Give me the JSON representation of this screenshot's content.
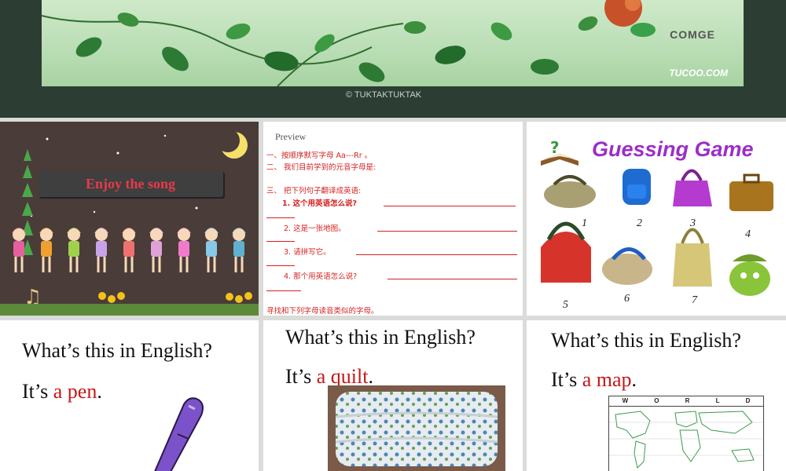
{
  "banner": {
    "brand_top": "COMGE",
    "brand_bottom": "TUCOO.COM",
    "credit": "© TUKTAKTUKTAK"
  },
  "slide1": {
    "title": "Enjoy the song"
  },
  "slide2": {
    "preview": "Preview",
    "line1": "一、按顺序默写字母 Aa---Rr 。",
    "line2": "二、 我们目前学到的元音字母是:",
    "line3": "三、 把下列句子翻译成英语:",
    "q1": "1. 这个用英语怎么说?",
    "q2": "2. 这是一张地图。",
    "q3": "3. 请拼写它。",
    "q4": "4. 那个用英语怎么说?",
    "footer": "寻找和下列字母读音类似的字母。"
  },
  "slide3": {
    "title": "Guessing   Game",
    "numbers": [
      "1",
      "2",
      "3",
      "4",
      "5",
      "6",
      "7"
    ]
  },
  "slide4": {
    "question": "What’s this in English?",
    "answer_prefix": "It’s ",
    "answer": "a pen",
    "answer_suffix": "."
  },
  "slide5": {
    "question": "What’s this in English?",
    "answer_prefix": "It’s ",
    "answer": "a quilt",
    "answer_suffix": "."
  },
  "slide6": {
    "question": "What’s this in English?",
    "answer_prefix": "It’s ",
    "answer": "a map",
    "answer_suffix": ".",
    "map_letters": [
      "W",
      "O",
      "R",
      "L",
      "D"
    ]
  }
}
